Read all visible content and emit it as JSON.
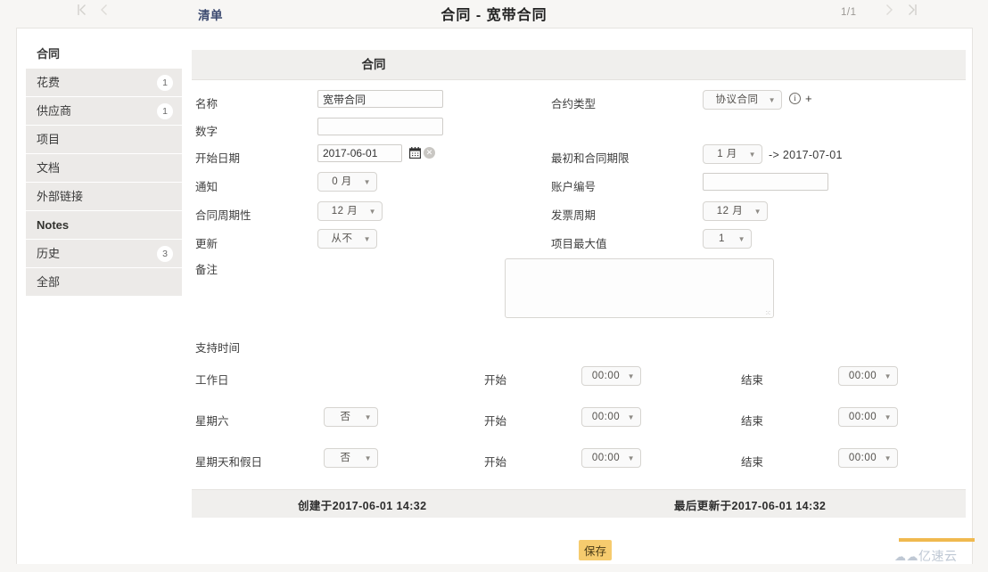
{
  "topbar": {
    "first_icon": "first-page-chevron-icon",
    "prev_icon": "previous-page-chevron-icon",
    "next_icon": "next-page-chevron-icon",
    "last_icon": "last-page-chevron-icon",
    "list_link": "清单",
    "title": "合同 - 宽带合同",
    "page_count": "1/1"
  },
  "sidebar": {
    "items": [
      {
        "label": "合同",
        "badge": ""
      },
      {
        "label": "花费",
        "badge": "1"
      },
      {
        "label": "供应商",
        "badge": "1"
      },
      {
        "label": "项目",
        "badge": ""
      },
      {
        "label": "文档",
        "badge": ""
      },
      {
        "label": "外部链接",
        "badge": ""
      },
      {
        "label": "Notes",
        "badge": ""
      },
      {
        "label": "历史",
        "badge": "3"
      },
      {
        "label": "全部",
        "badge": ""
      }
    ]
  },
  "panel": {
    "header": "合同",
    "fields": {
      "name_label": "名称",
      "name_value": "宽带合同",
      "number_label": "数字",
      "number_value": "",
      "start_date_label": "开始日期",
      "start_date_value": "2017-06-01",
      "calendar_icon": "calendar-icon",
      "clear_icon": "clear-date-icon",
      "notice_label": "通知",
      "notice_value": "0 月",
      "contract_cycle_label": "合同周期性",
      "contract_cycle_value": "12 月",
      "renew_label": "更新",
      "renew_value": "从不",
      "contract_type_label": "合约类型",
      "contract_type_value": "协议合同",
      "info_icon": "info-circle-icon",
      "plus_icon": "add-plus-icon",
      "term_label": "最初和合同期限",
      "term_value": "1 月",
      "term_arrow": "-> 2017-07-01",
      "account_no_label": "账户编号",
      "account_no_value": "",
      "invoice_cycle_label": "发票周期",
      "invoice_cycle_value": "12 月",
      "max_items_label": "项目最大值",
      "max_items_value": "1",
      "remark_label": "备注",
      "remark_value": "",
      "remark_grip_icon": "resize-grip-icon"
    },
    "support": {
      "section_label": "支持时间",
      "start_label": "开始",
      "end_label": "结束",
      "rows": [
        {
          "day": "工作日",
          "enabled": "",
          "start": "00:00",
          "end": "00:00"
        },
        {
          "day": "星期六",
          "enabled": "否",
          "start": "00:00",
          "end": "00:00"
        },
        {
          "day": "星期天和假日",
          "enabled": "否",
          "start": "00:00",
          "end": "00:00"
        }
      ]
    }
  },
  "footer": {
    "created": "创建于2017-06-01 14:32",
    "updated": "最后更新于2017-06-01 14:32",
    "save_label": "保存"
  },
  "watermark": {
    "cloud_icon": "cloud-logo-icon",
    "text": "亿速云"
  }
}
